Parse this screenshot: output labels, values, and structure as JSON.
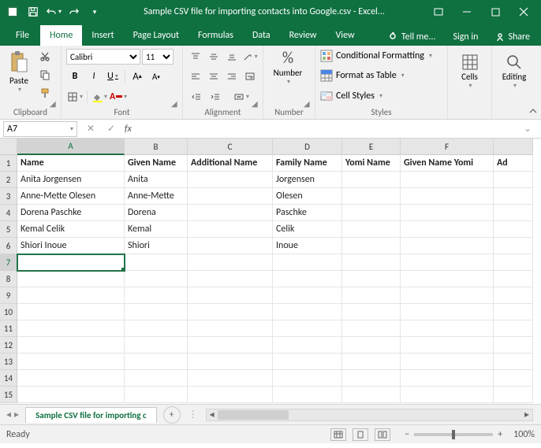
{
  "title": "Sample CSV file for importing contacts into Google.csv - Excel...",
  "qat": {
    "save": "save-icon",
    "undo": "undo-icon",
    "redo": "redo-icon",
    "touch": "touch-icon"
  },
  "tabs": {
    "file": "File",
    "home": "Home",
    "insert": "Insert",
    "pagelayout": "Page Layout",
    "formulas": "Formulas",
    "data": "Data",
    "review": "Review",
    "view": "View",
    "tellme": "Tell me...",
    "signin": "Sign in",
    "share": "Share"
  },
  "ribbon": {
    "clipboard": {
      "paste": "Paste",
      "label": "Clipboard"
    },
    "font": {
      "name": "Calibri",
      "size": "11",
      "label": "Font"
    },
    "alignment": {
      "label": "Alignment"
    },
    "number": {
      "btn": "Number",
      "label": "Number",
      "pct": "%"
    },
    "styles": {
      "cond": "Conditional Formatting",
      "table": "Format as Table",
      "cell": "Cell Styles",
      "label": "Styles"
    },
    "cells": {
      "btn": "Cells",
      "label": ""
    },
    "editing": {
      "btn": "Editing",
      "label": ""
    }
  },
  "namebox": "A7",
  "fx": "fx",
  "columns": [
    "A",
    "B",
    "C",
    "D",
    "E",
    "F"
  ],
  "partial_col": "Ad",
  "headers": [
    "Name",
    "Given Name",
    "Additional Name",
    "Family Name",
    "Yomi Name",
    "Given Name Yomi"
  ],
  "rows": [
    {
      "n": 2,
      "c": [
        "Anita Jorgensen",
        "Anita",
        "",
        "Jorgensen",
        "",
        ""
      ]
    },
    {
      "n": 3,
      "c": [
        "Anne-Mette Olesen",
        "Anne-Mette",
        "",
        "Olesen",
        "",
        ""
      ]
    },
    {
      "n": 4,
      "c": [
        "Dorena Paschke",
        "Dorena",
        "",
        "Paschke",
        "",
        ""
      ]
    },
    {
      "n": 5,
      "c": [
        "Kemal Celik",
        "Kemal",
        "",
        "Celik",
        "",
        ""
      ]
    },
    {
      "n": 6,
      "c": [
        "Shiori Inoue",
        "Shiori",
        "",
        "Inoue",
        "",
        ""
      ]
    }
  ],
  "emptyrows": [
    7,
    8,
    9,
    10,
    11,
    12,
    13,
    14,
    15
  ],
  "sheet": {
    "name": "Sample CSV file for importing c"
  },
  "status": {
    "ready": "Ready",
    "zoom": "100%"
  }
}
